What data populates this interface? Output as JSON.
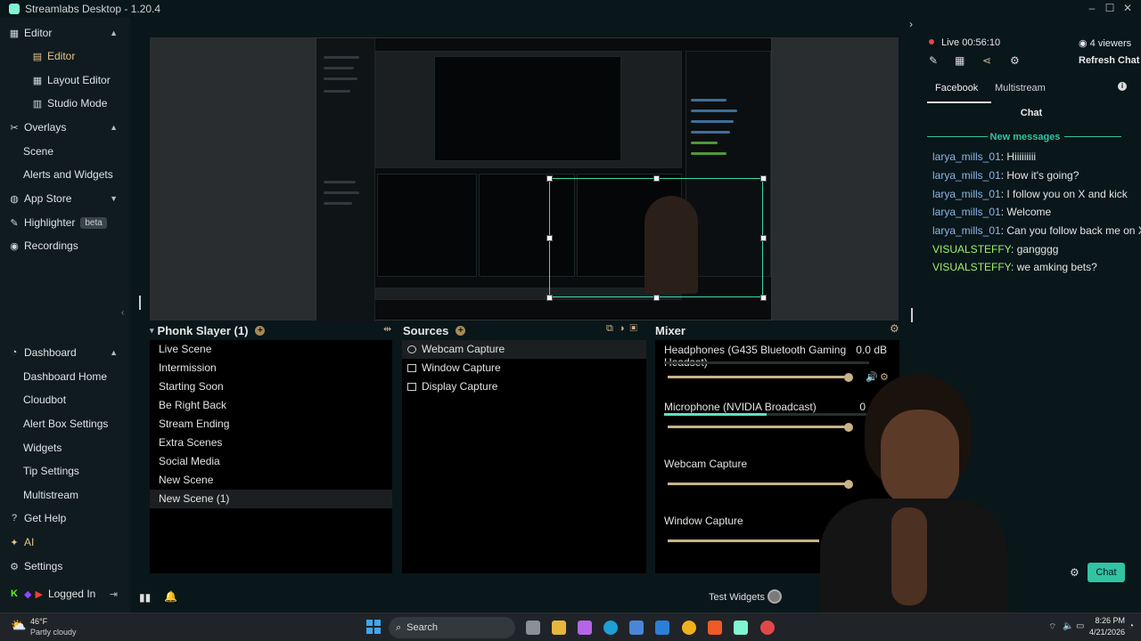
{
  "window": {
    "title": "Streamlabs Desktop - 1.20.4"
  },
  "sidebar": {
    "items": [
      {
        "label": "Editor",
        "icon": "editor-icon",
        "type": "section"
      },
      {
        "label": "Editor",
        "icon": "grid-icon",
        "type": "sub",
        "active": true
      },
      {
        "label": "Layout Editor",
        "icon": "layout-icon",
        "type": "sub"
      },
      {
        "label": "Studio Mode",
        "icon": "columns-icon",
        "type": "sub"
      },
      {
        "label": "Overlays",
        "icon": "tools-icon",
        "type": "section"
      },
      {
        "label": "Scene",
        "type": "sub"
      },
      {
        "label": "Alerts and Widgets",
        "type": "sub"
      },
      {
        "label": "App Store",
        "icon": "globe-icon",
        "type": "section"
      },
      {
        "label": "Highlighter",
        "icon": "highlighter-icon",
        "type": "section",
        "badge": "beta"
      },
      {
        "label": "Recordings",
        "icon": "record-icon",
        "type": "section"
      },
      {
        "label": "Dashboard",
        "icon": "dashboard-icon",
        "type": "section"
      },
      {
        "label": "Dashboard Home",
        "type": "sub"
      },
      {
        "label": "Cloudbot",
        "type": "sub"
      },
      {
        "label": "Alert Box Settings",
        "type": "sub"
      },
      {
        "label": "Widgets",
        "type": "sub"
      },
      {
        "label": "Tip Settings",
        "type": "sub"
      },
      {
        "label": "Multistream",
        "type": "sub"
      },
      {
        "label": "Get Help",
        "icon": "help-icon",
        "type": "section"
      },
      {
        "label": "AI",
        "icon": "ai-icon",
        "type": "section"
      },
      {
        "label": "Settings",
        "icon": "gear-icon",
        "type": "section"
      },
      {
        "label": "Logged In",
        "type": "section"
      }
    ]
  },
  "scenes": {
    "header": "Phonk Slayer (1)",
    "items": [
      "Live Scene",
      "Intermission",
      "Starting Soon",
      "Be Right Back",
      "Stream Ending",
      "Extra Scenes",
      "Social Media",
      "New Scene",
      "New Scene (1)"
    ],
    "selected_index": 8
  },
  "sources": {
    "header": "Sources",
    "items": [
      "Webcam Capture",
      "Window Capture",
      "Display Capture"
    ],
    "selected_index": 0
  },
  "mixer": {
    "header": "Mixer",
    "items": [
      {
        "name": "Headphones (G435 Bluetooth Gaming Headset)",
        "db": "0.0 dB",
        "level": 0.0,
        "volume": 0.96
      },
      {
        "name": "Microphone (NVIDIA Broadcast)",
        "db": "0",
        "level": 0.5,
        "volume": 0.96
      },
      {
        "name": "Webcam Capture",
        "db": "",
        "level": 0.0,
        "volume": 0.96
      },
      {
        "name": "Window Capture",
        "db": "",
        "level": 0.0,
        "volume": 0.96
      }
    ]
  },
  "bottom": {
    "test_widgets": "Test Widgets"
  },
  "live": {
    "status": "Live",
    "time": "00:56:10",
    "viewers": "4 viewers",
    "refresh": "Refresh Chat"
  },
  "chat": {
    "tabs": [
      "Facebook",
      "Multistream"
    ],
    "title": "Chat",
    "new_messages": "New messages",
    "messages": [
      {
        "user": "larya_mills_01",
        "text": ": Hiiiiiiiii",
        "color": "#8bb6e6"
      },
      {
        "user": "larya_mills_01",
        "text": ": How it's going?",
        "color": "#8bb6e6"
      },
      {
        "user": "larya_mills_01",
        "text": ": I follow you on X and kick",
        "color": "#8bb6e6"
      },
      {
        "user": "larya_mills_01",
        "text": ": Welcome",
        "color": "#8bb6e6"
      },
      {
        "user": "larya_mills_01",
        "text": ": Can you follow back me on X?",
        "color": "#8bb6e6"
      },
      {
        "user": "VISUALSTEFFY",
        "text": ": gangggg",
        "color": "#9df26b"
      },
      {
        "user": "VISUALSTEFFY",
        "text": ": we amking bets?",
        "color": "#9df26b"
      }
    ],
    "chat_button": "Chat"
  },
  "taskbar": {
    "weather_temp": "46°F",
    "weather_desc": "Partly cloudy",
    "search": "Search",
    "time": "8:26 PM",
    "date": "4/21/2026"
  },
  "colors": {
    "accent": "#a68a57",
    "teal": "#31c3a2",
    "live": "#e04848"
  }
}
